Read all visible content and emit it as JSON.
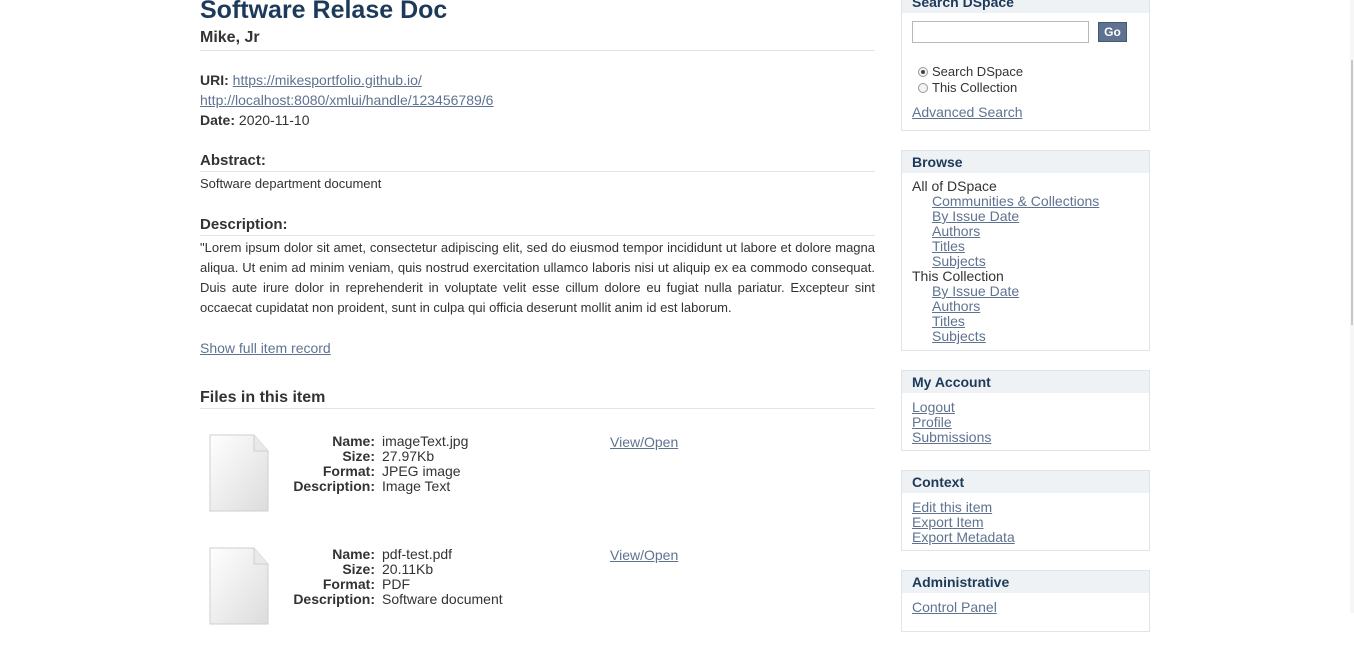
{
  "item": {
    "title": "Software Relase Doc",
    "author": "Mike, Jr",
    "uri_label": "URI:",
    "uri_1": "https://mikesportfolio.github.io/",
    "uri_2": "http://localhost:8080/xmlui/handle/123456789/6",
    "date_label": "Date:",
    "date": "2020-11-10",
    "abstract_heading": "Abstract:",
    "abstract": "Software department document",
    "description_heading": "Description:",
    "description": "\"Lorem ipsum dolor sit amet, consectetur adipiscing elit, sed do eiusmod tempor incididunt ut labore et dolore magna aliqua. Ut enim ad minim veniam, quis nostrud exercitation ullamco laboris nisi ut aliquip ex ea commodo consequat. Duis aute irure dolor in reprehenderit in voluptate velit esse cillum dolore eu fugiat nulla pariatur. Excepteur sint occaecat cupidatat non proident, sunt in culpa qui officia deserunt mollit anim id est laborum.",
    "show_full_record": "Show full item record"
  },
  "files": {
    "heading": "Files in this item",
    "labels": {
      "name": "Name:",
      "size": "Size:",
      "format": "Format:",
      "description": "Description:"
    },
    "view_label": "View/Open",
    "items": [
      {
        "name": "imageText.jpg",
        "size": "27.97Kb",
        "format": "JPEG image",
        "description": "Image Text"
      },
      {
        "name": "pdf-test.pdf",
        "size": "20.11Kb",
        "format": "PDF",
        "description": "Software document"
      }
    ]
  },
  "sidebar": {
    "search": {
      "heading": "Search DSpace",
      "go": "Go",
      "option_1": "Search DSpace",
      "option_2": "This Collection",
      "advanced": "Advanced Search"
    },
    "browse": {
      "heading": "Browse",
      "all_label": "All of DSpace",
      "all_links": [
        "Communities & Collections",
        "By Issue Date",
        "Authors",
        "Titles",
        "Subjects"
      ],
      "collection_label": "This Collection",
      "collection_links": [
        "By Issue Date",
        "Authors",
        "Titles",
        "Subjects"
      ]
    },
    "account": {
      "heading": "My Account",
      "links": [
        "Logout",
        "Profile",
        "Submissions"
      ]
    },
    "context": {
      "heading": "Context",
      "links": [
        "Edit this item",
        "Export Item",
        "Export Metadata"
      ]
    },
    "administrative": {
      "heading": "Administrative",
      "links": [
        "Control Panel"
      ]
    }
  }
}
